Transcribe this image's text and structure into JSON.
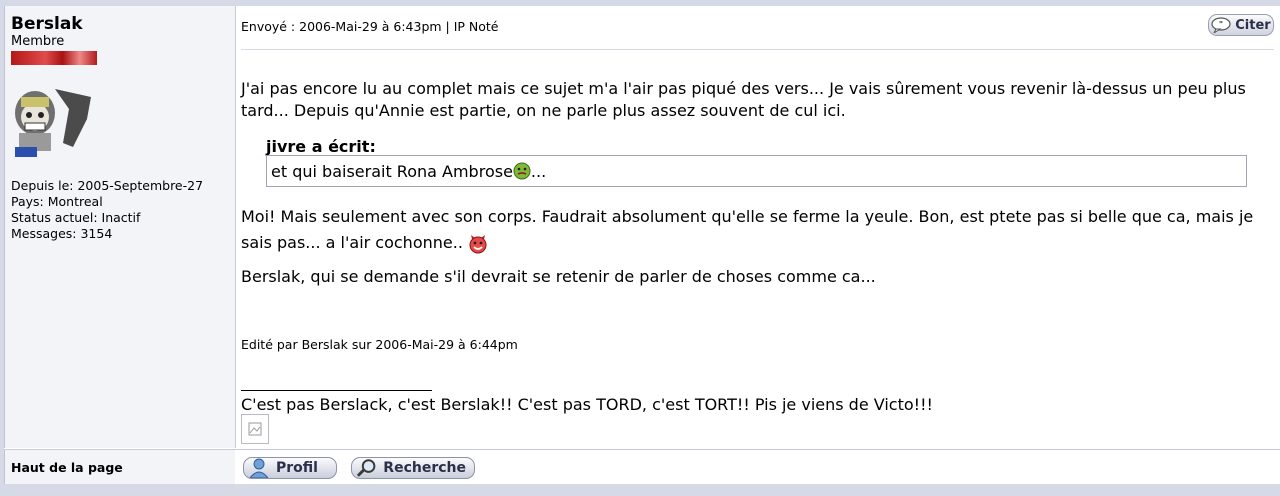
{
  "author": {
    "username": "Berslak",
    "rank": "Membre",
    "joined": "Depuis le: 2005-Septembre-27",
    "country": "Pays: Montreal",
    "status": "Status actuel: Inactif",
    "messages": "Messages: 3154"
  },
  "post": {
    "meta": "Envoyé : 2006-Mai-29 à 6:43pm | IP Noté",
    "quote_button": "Citer",
    "paragraph1": "J'ai pas encore lu au complet mais ce sujet m'a l'air pas piqué des vers...  Je vais sûrement vous revenir là-dessus un peu plus tard... Depuis qu'Annie est partie, on ne parle plus assez souvent de cul ici.",
    "quote_header": "jivre a écrit:",
    "quote_text": "et qui baiserait Rona Ambrose",
    "quote_tail": "...",
    "paragraph2": "Moi!  Mais seulement avec son corps.  Faudrait absolument qu'elle se ferme la yeule.  Bon, est ptete pas si belle que ca, mais je sais pas... a l'air cochonne..",
    "paragraph3": "Berslak, qui se demande s'il devrait se retenir de parler de choses comme ca...",
    "edited": "Edité par Berslak sur 2006-Mai-29 à 6:44pm",
    "signature": "C'est pas Berslack, c'est Berslak!!   C'est pas TORD, c'est TORT!!   Pis je viens de Victo!!!"
  },
  "footer": {
    "top_link": "Haut de la page",
    "profile_button": "Profil",
    "search_button": "Recherche"
  },
  "icons": {
    "quote": "speech-bubble-icon",
    "sick_emoticon": "sick-face-icon",
    "devil_emoticon": "devil-face-icon",
    "profile": "user-icon",
    "search": "magnifier-icon",
    "broken_image": "broken-image-icon"
  },
  "colors": {
    "page_bg": "#d6d9e6",
    "side_bg": "#f3f4f8",
    "button_text": "#2b2f4a",
    "rank_bar": "#c0282b"
  }
}
